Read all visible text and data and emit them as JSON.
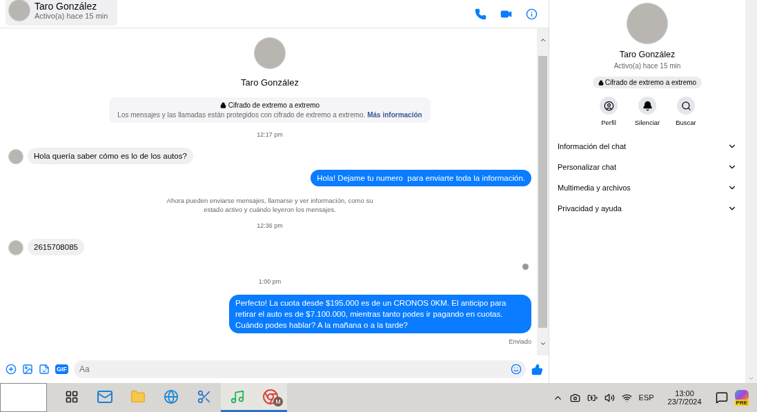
{
  "header": {
    "name": "Taro González",
    "status": "Activo(a) hace 15 min"
  },
  "profile": {
    "name": "Taro González"
  },
  "encryption": {
    "title": "Cifrado de extremo a extremo",
    "text": "Los mensajes y las llamadas están protegidos con cifrado de extremo a extremo.",
    "link": "Más información"
  },
  "messages": [
    {
      "kind": "time",
      "text": "12:17 pm"
    },
    {
      "kind": "incoming",
      "text": "Hola quería saber cómo es lo de los autos?"
    },
    {
      "kind": "outgoing",
      "text": "Hola! Dejame tu numero  para enviarte toda la información."
    },
    {
      "kind": "notice",
      "text": "Ahora pueden enviarse mensajes, llamarse y ver información, como su estado activo y cuándo leyeron los mensajes."
    },
    {
      "kind": "time",
      "text": "12:36 pm"
    },
    {
      "kind": "incoming",
      "text": "2615708085"
    },
    {
      "kind": "seen"
    },
    {
      "kind": "time",
      "text": "1:00 pm"
    },
    {
      "kind": "outgoing",
      "text": "Perfecto! La cuota desde $195.000 es de un CRONOS 0KM. El anticipo para retirar el auto es de $7.100.000, mientras tanto podes ir pagando en cuotas. Cuándo podes hablar? A la mañana o a la tarde?"
    },
    {
      "kind": "status",
      "text": "Enviado"
    }
  ],
  "composer": {
    "gif_label": "GIF",
    "placeholder": "Aa"
  },
  "panel": {
    "name": "Taro González",
    "status": "Activo(a) hace 15 min",
    "badge": "Cifrado de extremo a extremo",
    "actions": [
      {
        "kind": "profile",
        "label": "Perfil"
      },
      {
        "kind": "mute",
        "label": "Silenciar"
      },
      {
        "kind": "search",
        "label": "Buscar"
      }
    ],
    "sections": [
      {
        "label": "Información del chat",
        "expanded": false
      },
      {
        "label": "Personalizar chat",
        "expanded": false
      },
      {
        "label": "Multimedia y archivos",
        "expanded": false
      },
      {
        "label": "Privacidad y ayuda",
        "expanded": false
      }
    ]
  },
  "taskbar": {
    "apps": [
      {
        "kind": "taskview",
        "active": false
      },
      {
        "kind": "mail",
        "active": false
      },
      {
        "kind": "folder",
        "active": false
      },
      {
        "kind": "edge",
        "active": false
      },
      {
        "kind": "snip",
        "active": false
      },
      {
        "kind": "spotify",
        "active": true
      },
      {
        "kind": "chrome",
        "active": true,
        "badge": "M"
      }
    ],
    "language": "ESP",
    "time": "13:00",
    "date": "23/7/2024",
    "copilot_badge": "PRE"
  }
}
